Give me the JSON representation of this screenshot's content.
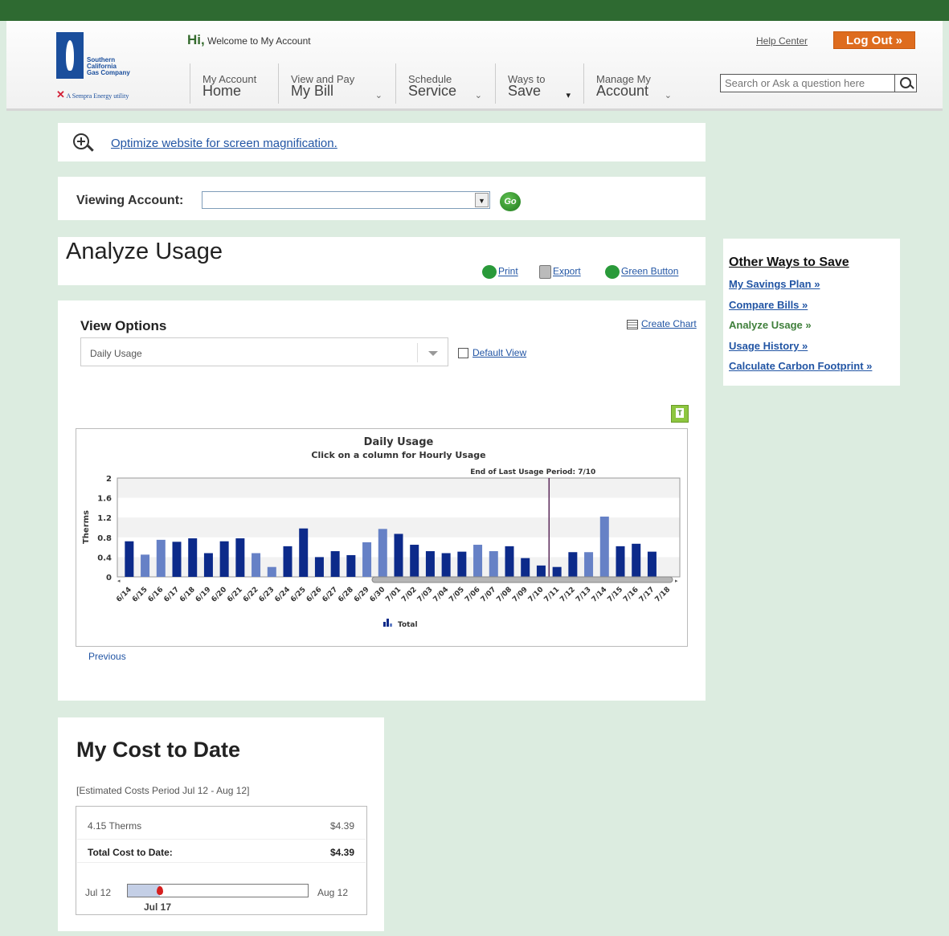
{
  "header": {
    "logo_lines": [
      "Southern",
      "California",
      "Gas Company"
    ],
    "logo_tagline": "A  Sempra Energy utility",
    "greeting_hi": "Hi,",
    "greeting_text": "Welcome to My Account",
    "help_center": "Help Center",
    "log_out": "Log Out »",
    "search_placeholder": "Search or Ask a question here",
    "nav": [
      {
        "small": "My Account",
        "big": "Home",
        "chevron": ""
      },
      {
        "small": "View and Pay",
        "big": "My Bill",
        "chevron": "⌄"
      },
      {
        "small": "Schedule",
        "big": "Service",
        "chevron": "⌄"
      },
      {
        "small": "Ways to",
        "big": "Save",
        "chevron": "▾"
      },
      {
        "small": "Manage My",
        "big": "Account",
        "chevron": "⌄"
      }
    ]
  },
  "magnification": {
    "link": "Optimize website for screen magnification."
  },
  "account": {
    "label": "Viewing Account:",
    "selected": "",
    "go": "Go"
  },
  "analyze": {
    "title": "Analyze Usage",
    "print": "Print",
    "export": "Export",
    "green_button": "Green Button"
  },
  "view_options": {
    "title": "View Options",
    "create_chart": "Create Chart",
    "selected": "Daily Usage",
    "default_view": "Default View",
    "previous": "Previous"
  },
  "chart_data": {
    "type": "bar",
    "title": "Daily Usage",
    "subtitle": "Click on a column for Hourly Usage",
    "ylabel": "Therms",
    "ylim": [
      0,
      2
    ],
    "yticks": [
      "0",
      "0.4",
      "0.8",
      "1.2",
      "1.6",
      "2"
    ],
    "annotation": "End of Last Usage Period: 7/10",
    "legend": "Total",
    "categories": [
      "6/14",
      "6/15",
      "6/16",
      "6/17",
      "6/18",
      "6/19",
      "6/20",
      "6/21",
      "6/22",
      "6/23",
      "6/24",
      "6/25",
      "6/26",
      "6/27",
      "6/28",
      "6/29",
      "6/30",
      "7/01",
      "7/02",
      "7/03",
      "7/04",
      "7/05",
      "7/06",
      "7/07",
      "7/08",
      "7/09",
      "7/10",
      "7/11",
      "7/12",
      "7/13",
      "7/14",
      "7/15",
      "7/16",
      "7/17",
      "7/18"
    ],
    "values": [
      0.72,
      0.45,
      0.75,
      0.71,
      0.78,
      0.48,
      0.72,
      0.78,
      0.48,
      0.2,
      0.62,
      0.98,
      0.4,
      0.52,
      0.44,
      0.7,
      0.97,
      0.87,
      0.65,
      0.52,
      0.48,
      0.51,
      0.65,
      0.52,
      0.62,
      0.38,
      0.23,
      0.2,
      0.5,
      0.5,
      1.22,
      0.62,
      0.67,
      0.51,
      0
    ],
    "shade": [
      "dark",
      "light",
      "light",
      "dark",
      "dark",
      "dark",
      "dark",
      "dark",
      "light",
      "light",
      "dark",
      "dark",
      "dark",
      "dark",
      "dark",
      "light",
      "light",
      "dark",
      "dark",
      "dark",
      "dark",
      "dark",
      "light",
      "light",
      "dark",
      "dark",
      "dark",
      "dark",
      "dark",
      "light",
      "light",
      "dark",
      "dark",
      "dark",
      "dark"
    ],
    "colors": {
      "dark": "#0c2a8a",
      "light": "#6681c6",
      "marker": "#5b2a5a"
    },
    "period_end_after": "7/11"
  },
  "sidebar": {
    "title": "Other Ways to Save",
    "links": [
      {
        "label": "My Savings Plan »"
      },
      {
        "label": "Compare Bills »"
      },
      {
        "label": "Analyze Usage »"
      },
      {
        "label": "Usage History »"
      },
      {
        "label": "Calculate Carbon Footprint »"
      }
    ]
  },
  "cost": {
    "title": "My Cost to Date",
    "period": "[Estimated Costs Period Jul 12 - Aug 12]",
    "rows": [
      {
        "label": "4.15 Therms",
        "value": "$4.39"
      },
      {
        "label": "Total Cost to Date:",
        "value": "$4.39"
      }
    ],
    "range_start": "Jul 12",
    "range_end": "Aug 12",
    "current": "Jul 17",
    "progress_fraction": 0.18
  }
}
